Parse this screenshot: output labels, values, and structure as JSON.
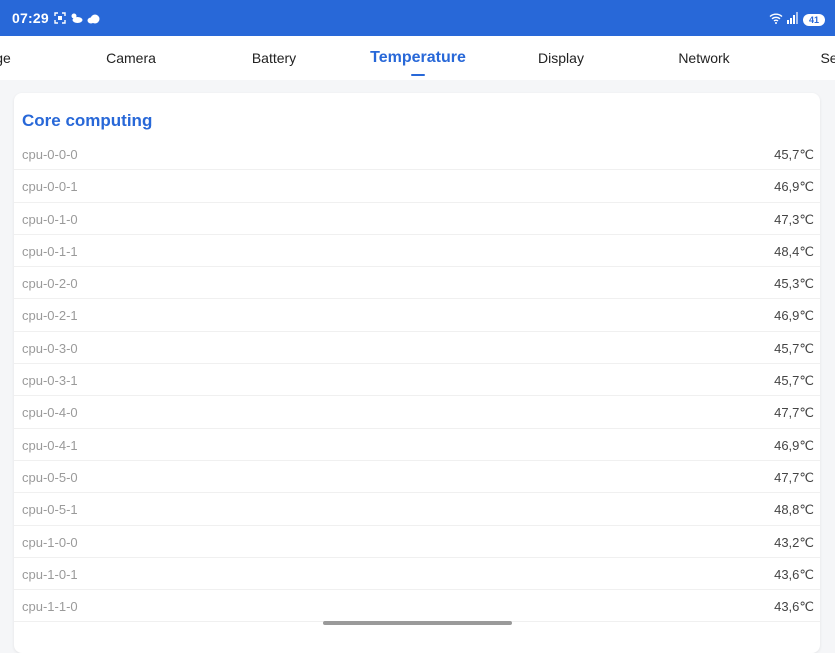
{
  "status": {
    "time": "07:29",
    "battery": "41"
  },
  "tabs": [
    {
      "label": "ge"
    },
    {
      "label": "Camera"
    },
    {
      "label": "Battery"
    },
    {
      "label": "Temperature"
    },
    {
      "label": "Display"
    },
    {
      "label": "Network"
    },
    {
      "label": "Se"
    }
  ],
  "section": {
    "title": "Core computing"
  },
  "rows": [
    {
      "name": "cpu-0-0-0",
      "value": "45,7℃"
    },
    {
      "name": "cpu-0-0-1",
      "value": "46,9℃"
    },
    {
      "name": "cpu-0-1-0",
      "value": "47,3℃"
    },
    {
      "name": "cpu-0-1-1",
      "value": "48,4℃"
    },
    {
      "name": "cpu-0-2-0",
      "value": "45,3℃"
    },
    {
      "name": "cpu-0-2-1",
      "value": "46,9℃"
    },
    {
      "name": "cpu-0-3-0",
      "value": "45,7℃"
    },
    {
      "name": "cpu-0-3-1",
      "value": "45,7℃"
    },
    {
      "name": "cpu-0-4-0",
      "value": "47,7℃"
    },
    {
      "name": "cpu-0-4-1",
      "value": "46,9℃"
    },
    {
      "name": "cpu-0-5-0",
      "value": "47,7℃"
    },
    {
      "name": "cpu-0-5-1",
      "value": "48,8℃"
    },
    {
      "name": "cpu-1-0-0",
      "value": "43,2℃"
    },
    {
      "name": "cpu-1-0-1",
      "value": "43,6℃"
    },
    {
      "name": "cpu-1-1-0",
      "value": "43,6℃"
    }
  ],
  "colors": {
    "accent": "#2868d8",
    "status_bar": "#2868d8"
  },
  "icons": [
    "screenshot-icon",
    "weather-icon",
    "cloud-icon",
    "wifi-icon",
    "signal-icon",
    "battery-icon"
  ]
}
